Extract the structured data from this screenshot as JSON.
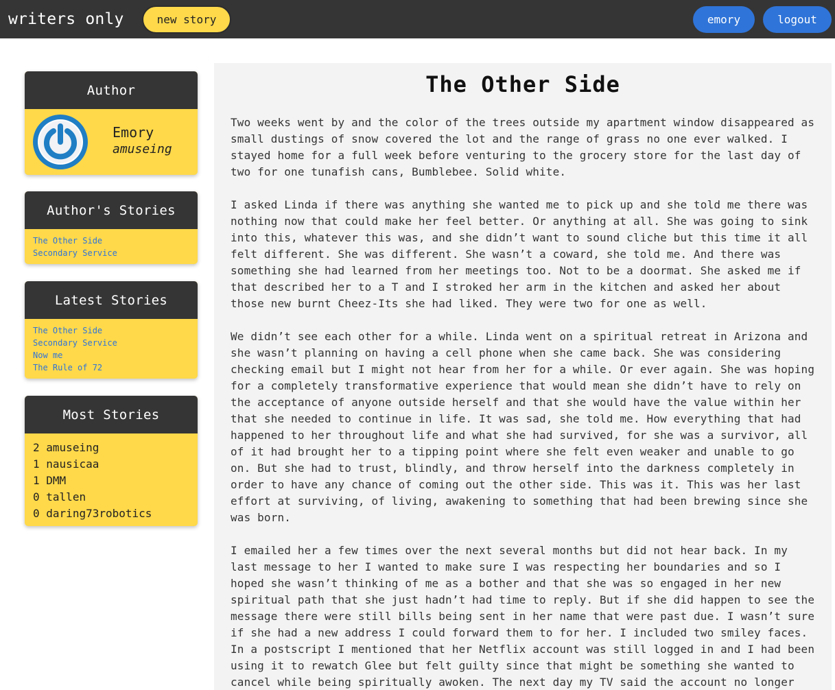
{
  "nav": {
    "brand": "writers only",
    "new_story": "new story",
    "user": "emory",
    "logout": "logout"
  },
  "author_card": {
    "heading": "Author",
    "name": "Emory",
    "handle": "amuseing",
    "avatar_icon": "power-icon"
  },
  "author_stories": {
    "heading": "Author's Stories",
    "items": [
      "The Other Side",
      "Secondary Service"
    ]
  },
  "latest_stories": {
    "heading": "Latest Stories",
    "items": [
      "The Other Side",
      "Secondary Service",
      "Now me",
      "The Rule of 72"
    ]
  },
  "most_stories": {
    "heading": "Most Stories",
    "rows": [
      {
        "count": "2",
        "user": "amuseing"
      },
      {
        "count": "1",
        "user": "nausicaa"
      },
      {
        "count": "1",
        "user": "DMM"
      },
      {
        "count": "0",
        "user": "tallen"
      },
      {
        "count": "0",
        "user": "daring73robotics"
      }
    ]
  },
  "story": {
    "title": "The Other Side",
    "paragraphs": [
      "Two weeks went by and the color of the trees outside my apartment window disappeared as small dustings of snow covered the lot and the range of grass no one ever walked. I stayed home for a full week before venturing to the grocery store for the last day of two for one tunafish cans, Bumblebee. Solid white.",
      "I asked Linda if there was anything she wanted me to pick up and she told me there was nothing now that could make her feel better. Or anything at all. She was going to sink into this, whatever this was, and she didn’t want to sound cliche but this time it all felt different. She was different. She wasn’t a coward, she told me. And there was something she had learned from her meetings too. Not to be a doormat. She asked me if that described her to a T and I stroked her arm in the kitchen and asked her about those new burnt Cheez-Its she had liked. They were two for one as well.",
      "We didn’t see each other for a while. Linda went on a spiritual retreat in Arizona and she wasn’t planning on having a cell phone when she came back. She was considering checking email but I might not hear from her for a while. Or ever again. She was hoping for a completely transformative experience that would mean she didn’t have to rely on the acceptance of anyone outside herself and that she would have the value within her that she needed to continue in life. It was sad, she told me. How everything that had happened to her throughout life and what she had survived, for she was a survivor, all of it had brought her to a tipping point where she felt even weaker and unable to go on. But she had to trust, blindly, and throw herself into the darkness completely in order to have any chance of coming out the other side. This was it. This was her last effort at surviving, of living, awakening to something that had been brewing since she was born.",
      "I emailed her a few times over the next several months but did not hear back. In my last message to her I wanted to make sure I was respecting her boundaries and so I hoped she wasn’t thinking of me as a bother and that she was so engaged in her new spiritual path that she just hadn’t had time to reply. But if she did happen to see the message there were still bills being sent in her name that were past due. I wasn’t sure if she had a new address I could forward them to for her. I included two smiley faces. In a postscript I mentioned that her Netflix account was still logged in and I had been using it to rewatch Glee but felt guilty since that might be something she wanted to cancel while being spiritually awoken. The next day my TV said the account no longer existed so"
    ]
  },
  "colors": {
    "nav_bg": "#353535",
    "accent_yellow": "#ffd94a",
    "accent_blue": "#2f74d8",
    "panel_bg": "#f3f3f3"
  }
}
